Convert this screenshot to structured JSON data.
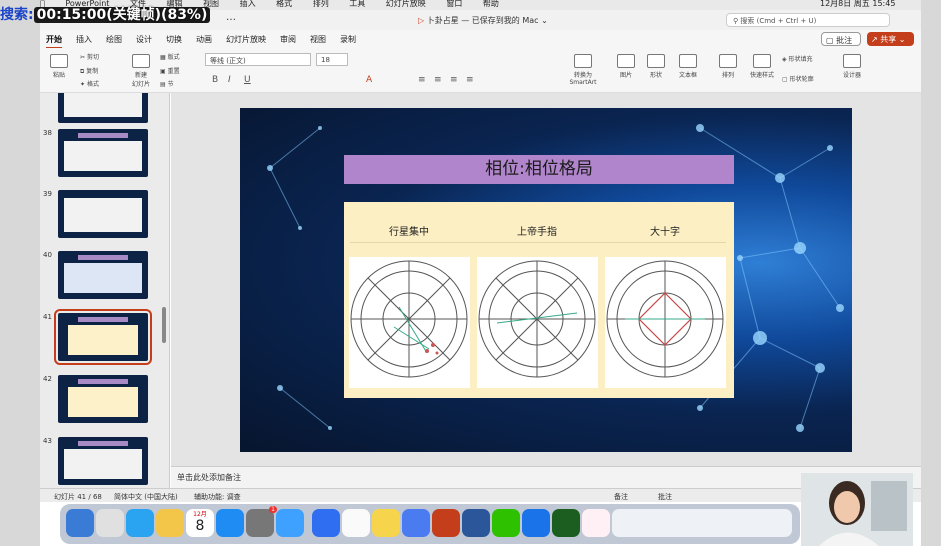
{
  "overlay": {
    "label": "搜索:",
    "clock": "00:15:00(关键帧)(83%)"
  },
  "menubar": {
    "items": [
      "PowerPoint",
      "文件",
      "编辑",
      "视图",
      "插入",
      "格式",
      "排列",
      "工具",
      "幻灯片放映",
      "窗口",
      "帮助"
    ],
    "clock": "12月8日 周五 15:45"
  },
  "titlebar": {
    "doc_prefix": "▷",
    "doc_name": "卜卦占星 — 已保存到我的 Mac",
    "ellipsis": "…",
    "search_placeholder": "搜索 (Cmd + Ctrl + U)"
  },
  "tabs": [
    "开始",
    "插入",
    "绘图",
    "设计",
    "切换",
    "动画",
    "幻灯片放映",
    "审阅",
    "视图",
    "录制"
  ],
  "actions": {
    "comment": "批注",
    "share": "共享"
  },
  "ribbon": {
    "paste": "粘贴",
    "cut": "剪切",
    "copy": "复制",
    "format": "格式",
    "new_slide": "新建\n幻灯片",
    "layout": "版式",
    "reset": "重置",
    "section": "节",
    "font": "等线 (正文)",
    "size": "18",
    "smartart": "转换为\nSmartArt",
    "picture": "图片",
    "shape": "形状",
    "textbox": "文本框",
    "arrange": "排列",
    "quick_style": "快速样式",
    "shape_fill": "形状填充",
    "shape_outline": "形状轮廓",
    "designer": "设计器"
  },
  "thumbs": [
    {
      "num": "38"
    },
    {
      "num": "39"
    },
    {
      "num": "40"
    },
    {
      "num": "41"
    },
    {
      "num": "42"
    },
    {
      "num": "43"
    }
  ],
  "slide": {
    "title": "相位:相位格局",
    "panels": [
      {
        "title": "行星集中"
      },
      {
        "title": "上帝手指"
      },
      {
        "title": "大十字"
      }
    ]
  },
  "notes": {
    "placeholder": "单击此处添加备注"
  },
  "status": {
    "slide": "幻灯片 41 / 68",
    "lang": "简体中文 (中国大陆)",
    "access": "辅助功能: 调查",
    "notes": "备注",
    "comments": "批注"
  },
  "dock": {
    "calendar_month": "12月",
    "calendar_day": "8",
    "badge": "1"
  },
  "colors": {
    "accent": "#c43e1c",
    "title_bar": "#b085cc",
    "card": "#fcefc4"
  }
}
